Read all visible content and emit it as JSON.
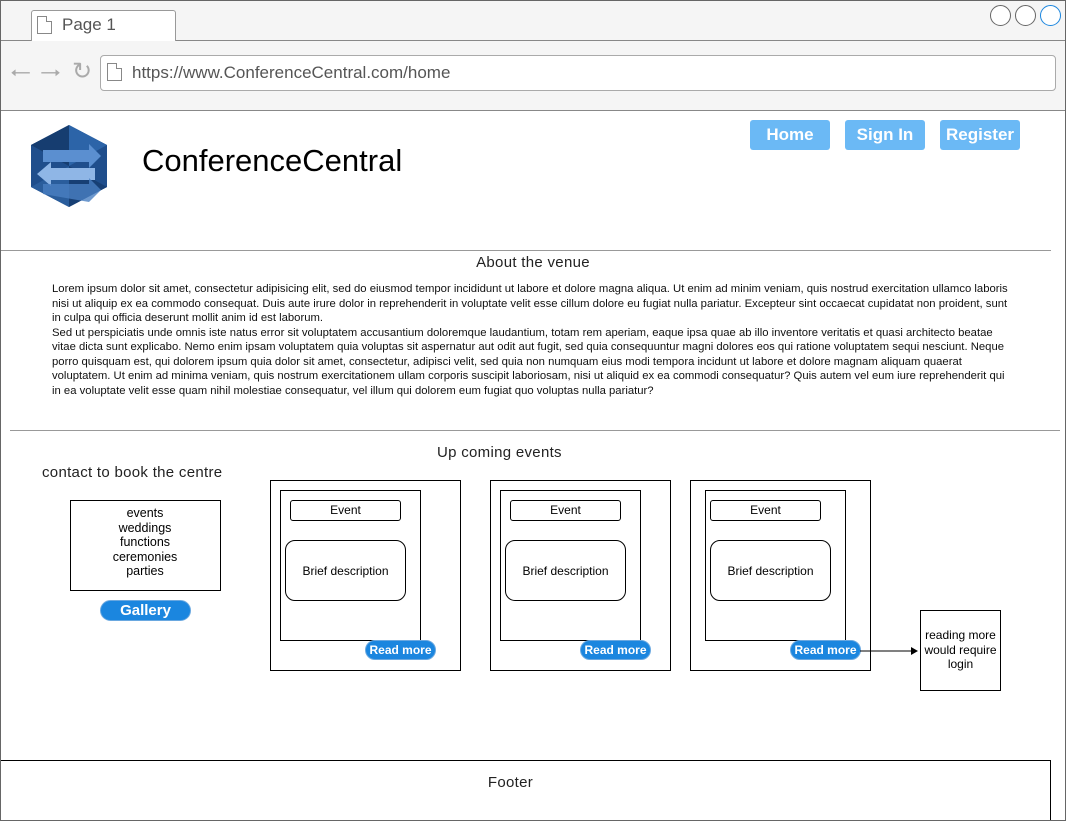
{
  "browser": {
    "tab_label": "Page 1",
    "url": "https://www.ConferenceCentral.com/home",
    "window_controls": [
      "circle-icon",
      "circle-icon",
      "circle-icon"
    ],
    "nav_icons": [
      "back-arrow-icon",
      "forward-arrow-icon",
      "reload-icon",
      "page-icon"
    ]
  },
  "header": {
    "site_title": "ConferenceCentral",
    "logo_icon": "hexagon-arrows-logo",
    "nav": {
      "home": "Home",
      "sign_in": "Sign In",
      "register": "Register"
    },
    "colors": {
      "nav_button": "#6bb9f5",
      "accent_button": "#1b86df"
    }
  },
  "about": {
    "heading": "About the venue",
    "paragraph1": "Lorem ipsum dolor sit amet, consectetur adipisicing elit, sed do eiusmod tempor incididunt ut labore et dolore magna aliqua. Ut enim ad minim veniam, quis nostrud exercitation ullamco laboris nisi ut aliquip ex ea commodo consequat. Duis aute irure dolor in reprehenderit in voluptate velit esse cillum dolore eu fugiat nulla pariatur. Excepteur sint occaecat cupidatat non proident, sunt in culpa qui officia deserunt mollit anim id est laborum.",
    "paragraph2": "Sed ut perspiciatis unde omnis iste natus error sit voluptatem accusantium doloremque laudantium, totam rem aperiam, eaque ipsa quae ab illo inventore veritatis et quasi architecto beatae vitae dicta sunt explicabo. Nemo enim ipsam voluptatem quia voluptas sit aspernatur aut odit aut fugit, sed quia consequuntur magni dolores eos qui ratione voluptatem sequi nesciunt. Neque porro quisquam est, qui dolorem ipsum quia dolor sit amet, consectetur, adipisci velit, sed quia non numquam eius modi tempora incidunt ut labore et dolore magnam aliquam quaerat voluptatem. Ut enim ad minima veniam, quis nostrum exercitationem ullam corporis suscipit laboriosam, nisi ut aliquid ex ea commodi consequatur? Quis autem vel eum iure reprehenderit qui in ea voluptate velit esse quam nihil molestiae consequatur, vel illum qui dolorem eum fugiat quo voluptas nulla pariatur?"
  },
  "booking": {
    "heading": "contact to book the centre",
    "items": [
      "events",
      "weddings",
      "functions",
      "ceremonies",
      "parties"
    ],
    "gallery_button": "Gallery"
  },
  "events": {
    "heading": "Up coming events",
    "cards": [
      {
        "title": "Event",
        "description": "Brief description",
        "read_more": "Read more"
      },
      {
        "title": "Event",
        "description": "Brief description",
        "read_more": "Read more"
      },
      {
        "title": "Event",
        "description": "Brief description",
        "read_more": "Read more"
      }
    ],
    "note": "reading more would require login"
  },
  "footer": {
    "label": "Footer"
  }
}
